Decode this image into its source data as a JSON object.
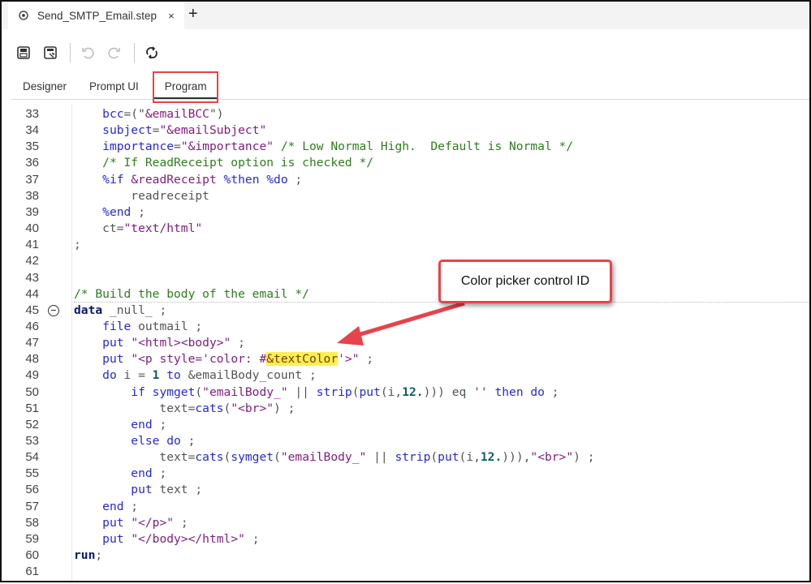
{
  "file_tab": {
    "title": "Send_SMTP_Email.step",
    "close": "×",
    "new_tab": "+"
  },
  "toolbar": {
    "icons": [
      "save-icon",
      "save-as-icon",
      "undo-icon",
      "redo-icon",
      "refresh-icon"
    ]
  },
  "view_tabs": [
    {
      "label": "Designer"
    },
    {
      "label": "Prompt UI"
    },
    {
      "label": "Program",
      "active": true
    }
  ],
  "annotation": {
    "callout": "Color picker control ID",
    "color": "#e8424a"
  },
  "editor": {
    "lines": [
      {
        "n": "33",
        "seg": [
          [
            "p",
            "    "
          ],
          [
            "k",
            "bcc"
          ],
          [
            "p",
            "=(\""
          ],
          [
            "s",
            "&emailBCC"
          ],
          [
            "p",
            "\")"
          ]
        ]
      },
      {
        "n": "34",
        "seg": [
          [
            "p",
            "    "
          ],
          [
            "k",
            "subject"
          ],
          [
            "p",
            "="
          ],
          [
            "s",
            "\"&emailSubject\""
          ]
        ]
      },
      {
        "n": "35",
        "seg": [
          [
            "p",
            "    "
          ],
          [
            "k",
            "importance"
          ],
          [
            "p",
            "="
          ],
          [
            "s",
            "\"&importance\""
          ],
          [
            "p",
            " "
          ],
          [
            "c",
            "/* Low Normal High.  Default is Normal */"
          ]
        ]
      },
      {
        "n": "36",
        "seg": [
          [
            "p",
            "    "
          ],
          [
            "c",
            "/* If ReadReceipt option is checked */"
          ]
        ]
      },
      {
        "n": "37",
        "seg": [
          [
            "p",
            "    "
          ],
          [
            "k",
            "%if"
          ],
          [
            "p",
            " "
          ],
          [
            "s",
            "&readReceipt"
          ],
          [
            "p",
            " "
          ],
          [
            "k",
            "%then %do"
          ],
          [
            "p",
            " ;"
          ]
        ]
      },
      {
        "n": "38",
        "seg": [
          [
            "p",
            "        readreceipt"
          ]
        ]
      },
      {
        "n": "39",
        "seg": [
          [
            "p",
            "    "
          ],
          [
            "k",
            "%end"
          ],
          [
            "p",
            " ;"
          ]
        ]
      },
      {
        "n": "40",
        "seg": [
          [
            "p",
            "    ct="
          ],
          [
            "s",
            "\"text/html\""
          ]
        ]
      },
      {
        "n": "41",
        "seg": [
          [
            "p",
            ";"
          ]
        ]
      },
      {
        "n": "42",
        "seg": []
      },
      {
        "n": "43",
        "seg": []
      },
      {
        "n": "44",
        "seg": [
          [
            "c",
            "/* Build the body of the email */"
          ]
        ]
      },
      {
        "n": "45",
        "fold": true,
        "seg": [
          [
            "b",
            "data"
          ],
          [
            "p",
            " _null_ ;"
          ]
        ]
      },
      {
        "n": "46",
        "seg": [
          [
            "p",
            "    "
          ],
          [
            "k",
            "file"
          ],
          [
            "p",
            " outmail ;"
          ]
        ]
      },
      {
        "n": "47",
        "seg": [
          [
            "p",
            "    "
          ],
          [
            "k",
            "put"
          ],
          [
            "p",
            " "
          ],
          [
            "s",
            "\"<html><body>\""
          ],
          [
            "p",
            " ;"
          ]
        ]
      },
      {
        "n": "48",
        "seg": [
          [
            "p",
            "    "
          ],
          [
            "k",
            "put"
          ],
          [
            "p",
            " "
          ],
          [
            "s",
            "\"<p style='color: #"
          ],
          [
            "h",
            "&textColor"
          ],
          [
            "s",
            "'>\""
          ],
          [
            "p",
            " ;"
          ]
        ]
      },
      {
        "n": "49",
        "seg": [
          [
            "p",
            "    "
          ],
          [
            "k",
            "do"
          ],
          [
            "p",
            " i = "
          ],
          [
            "n",
            "1"
          ],
          [
            "p",
            " "
          ],
          [
            "k",
            "to"
          ],
          [
            "p",
            " &emailBody_count ;"
          ]
        ]
      },
      {
        "n": "50",
        "seg": [
          [
            "p",
            "        "
          ],
          [
            "k",
            "if symget"
          ],
          [
            "p",
            "("
          ],
          [
            "s",
            "\"emailBody_\""
          ],
          [
            "p",
            " || "
          ],
          [
            "k",
            "strip"
          ],
          [
            "p",
            "("
          ],
          [
            "k",
            "put"
          ],
          [
            "p",
            "(i,"
          ],
          [
            "n",
            "12."
          ],
          [
            "p",
            ")))"
          ],
          [
            "p",
            " eq "
          ],
          [
            "s",
            "''"
          ],
          [
            "p",
            " "
          ],
          [
            "k",
            "then do"
          ],
          [
            "p",
            " ;"
          ]
        ]
      },
      {
        "n": "51",
        "seg": [
          [
            "p",
            "            text="
          ],
          [
            "k",
            "cats"
          ],
          [
            "p",
            "("
          ],
          [
            "s",
            "\"<br>\""
          ],
          [
            "p",
            ") ;"
          ]
        ]
      },
      {
        "n": "52",
        "seg": [
          [
            "p",
            "        "
          ],
          [
            "k",
            "end"
          ],
          [
            "p",
            " ;"
          ]
        ]
      },
      {
        "n": "53",
        "seg": [
          [
            "p",
            "        "
          ],
          [
            "k",
            "else do"
          ],
          [
            "p",
            " ;"
          ]
        ]
      },
      {
        "n": "54",
        "seg": [
          [
            "p",
            "            text="
          ],
          [
            "k",
            "cats"
          ],
          [
            "p",
            "("
          ],
          [
            "k",
            "symget"
          ],
          [
            "p",
            "("
          ],
          [
            "s",
            "\"emailBody_\""
          ],
          [
            "p",
            " || "
          ],
          [
            "k",
            "strip"
          ],
          [
            "p",
            "("
          ],
          [
            "k",
            "put"
          ],
          [
            "p",
            "(i,"
          ],
          [
            "n",
            "12."
          ],
          [
            "p",
            ")))"
          ],
          [
            "p",
            ","
          ],
          [
            "s",
            "\"<br>\""
          ],
          [
            "p",
            ") ;"
          ]
        ]
      },
      {
        "n": "55",
        "seg": [
          [
            "p",
            "        "
          ],
          [
            "k",
            "end"
          ],
          [
            "p",
            " ;"
          ]
        ]
      },
      {
        "n": "56",
        "seg": [
          [
            "p",
            "        "
          ],
          [
            "k",
            "put"
          ],
          [
            "p",
            " text ;"
          ]
        ]
      },
      {
        "n": "57",
        "seg": [
          [
            "p",
            "    "
          ],
          [
            "k",
            "end"
          ],
          [
            "p",
            " ;"
          ]
        ]
      },
      {
        "n": "58",
        "seg": [
          [
            "p",
            "    "
          ],
          [
            "k",
            "put"
          ],
          [
            "p",
            " "
          ],
          [
            "s",
            "\"</p>\""
          ],
          [
            "p",
            " ;"
          ]
        ]
      },
      {
        "n": "59",
        "seg": [
          [
            "p",
            "    "
          ],
          [
            "k",
            "put"
          ],
          [
            "p",
            " "
          ],
          [
            "s",
            "\"</body></html>\""
          ],
          [
            "p",
            " ;"
          ]
        ]
      },
      {
        "n": "60",
        "seg": [
          [
            "b",
            "run"
          ],
          [
            "p",
            ";"
          ]
        ]
      },
      {
        "n": "61",
        "seg": []
      }
    ]
  }
}
